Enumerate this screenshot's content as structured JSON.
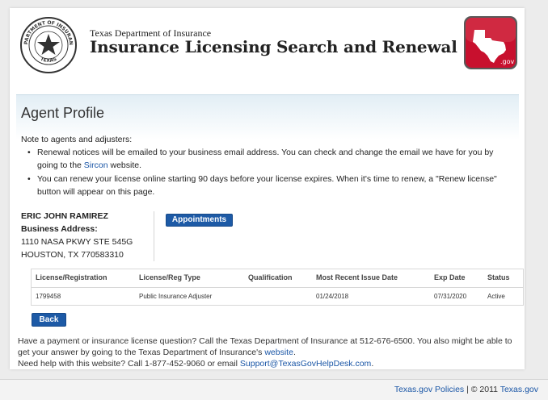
{
  "header": {
    "seal_alt": "Department of Insurance seal",
    "seal_text_top": "DEPARTMENT OF INSURANCE",
    "seal_text_bottom": "TEXAS",
    "agency": "Texas Department of Insurance",
    "title": "Insurance Licensing Search and Renewal",
    "txgov_label": ".gov"
  },
  "profile": {
    "title": "Agent Profile",
    "note_heading": "Note to agents and adjusters:",
    "bullet1_before": "Renewal notices will be emailed to your business email address. You can check and change the email we have for you by going to the ",
    "bullet1_link": "Sircon",
    "bullet1_after": " website.",
    "bullet2": "You can renew your license online starting 90 days before your license expires. When it's time to renew, a \"Renew license\" button will appear on this page.",
    "agent_name": "ERIC JOHN RAMIREZ",
    "address_label": "Business Address:",
    "address_line1": "1110 NASA PKWY STE 545G",
    "address_line2": "HOUSTON, TX 770583310",
    "appointments_button": "Appointments",
    "back_button": "Back"
  },
  "license_table": {
    "headers": [
      "License/Registration",
      "License/Reg Type",
      "Qualification",
      "Most Recent Issue Date",
      "Exp Date",
      "Status"
    ],
    "rows": [
      [
        "1799458",
        "Public Insurance Adjuster",
        "",
        "01/24/2018",
        "07/31/2020",
        "Active"
      ]
    ]
  },
  "help": {
    "line1_before": "Have a payment or insurance license question? Call the Texas Department of Insurance at 512-676-6500. You also might be able to get your answer by going to the Texas Department of Insurance's ",
    "line1_link": "website",
    "line1_after": ".",
    "line2_before": "Need help with this website? Call 1-877-452-9060 or email ",
    "line2_link": "Support@TexasGovHelpDesk.com",
    "line2_after": "."
  },
  "footer": {
    "policies_link": "Texas.gov Policies",
    "separator": " | © 2011 ",
    "site_link": "Texas.gov"
  },
  "colors": {
    "link": "#1a56a6",
    "button": "#1d5aa6",
    "txgov_red": "#c8102e"
  }
}
